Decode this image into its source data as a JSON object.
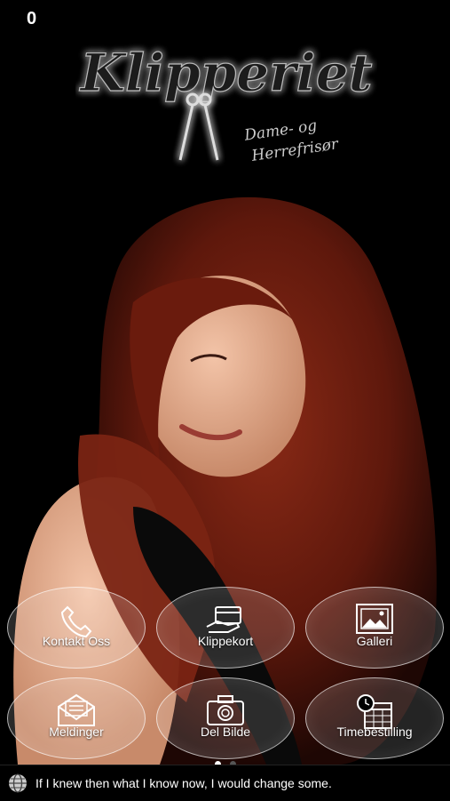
{
  "status": {
    "badge_count": "0"
  },
  "brand": {
    "name": "Klipperiet",
    "tagline_line1": "Dame- og",
    "tagline_line2": "Herrefrisør"
  },
  "menu": {
    "items": [
      {
        "label": "Kontakt Oss",
        "icon": "phone-icon"
      },
      {
        "label": "Klippekort",
        "icon": "card-in-hand-icon"
      },
      {
        "label": "Galleri",
        "icon": "picture-frame-icon"
      },
      {
        "label": "Meldinger",
        "icon": "envelope-icon"
      },
      {
        "label": "Del Bilde",
        "icon": "camera-icon"
      },
      {
        "label": "Timebestilling",
        "icon": "calendar-clock-icon"
      }
    ]
  },
  "pager": {
    "pages": 2,
    "active": 1
  },
  "ticker": {
    "text": "If I knew then what I know now, I would change some."
  },
  "colors": {
    "background": "#000000",
    "hair": "#6b1d10",
    "tile_fill": "rgba(255,255,255,0.14)"
  }
}
